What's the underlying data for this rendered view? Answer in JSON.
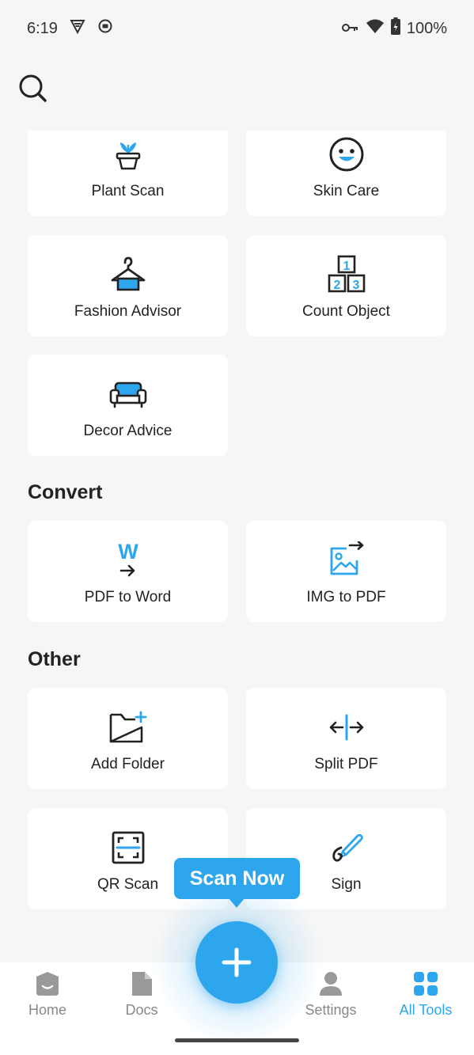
{
  "status_bar": {
    "time": "6:19",
    "battery": "100%"
  },
  "tools_top": [
    {
      "label": "Plant Scan",
      "icon": "plant-icon"
    },
    {
      "label": "Skin Care",
      "icon": "smiley-icon"
    },
    {
      "label": "Fashion Advisor",
      "icon": "hanger-icon"
    },
    {
      "label": "Count Object",
      "icon": "number-blocks-icon"
    },
    {
      "label": "Decor Advice",
      "icon": "sofa-icon"
    }
  ],
  "sections": {
    "convert": {
      "title": "Convert",
      "items": [
        {
          "label": "PDF to Word",
          "icon": "word-convert-icon"
        },
        {
          "label": "IMG to PDF",
          "icon": "image-convert-icon"
        }
      ]
    },
    "other": {
      "title": "Other",
      "items": [
        {
          "label": "Add Folder",
          "icon": "add-folder-icon"
        },
        {
          "label": "Split PDF",
          "icon": "split-icon"
        },
        {
          "label": "QR Scan",
          "icon": "qr-scan-icon"
        },
        {
          "label": "Sign",
          "icon": "pen-sign-icon"
        }
      ]
    }
  },
  "scan_tooltip": "Scan Now",
  "bottom_nav": [
    {
      "label": "Home",
      "icon": "home-icon"
    },
    {
      "label": "Docs",
      "icon": "docs-icon"
    },
    {
      "label": "Settings",
      "icon": "person-icon"
    },
    {
      "label": "All Tools",
      "icon": "grid-icon"
    }
  ],
  "colors": {
    "accent": "#2ea6ee",
    "background": "#f6f6f6",
    "card": "#ffffff"
  }
}
